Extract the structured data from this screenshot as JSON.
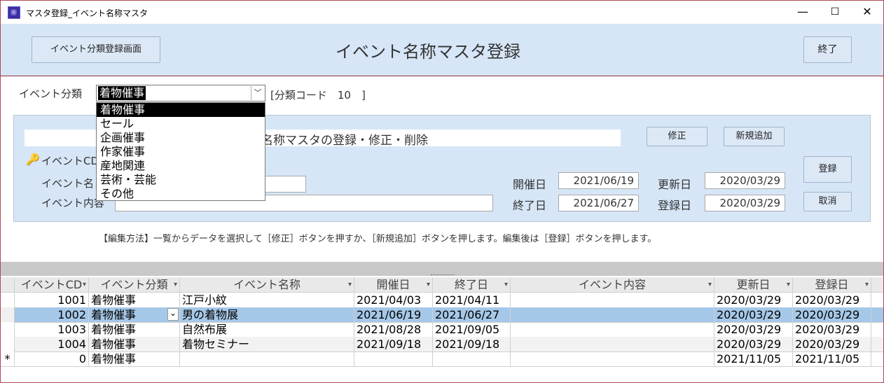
{
  "window": {
    "title": "マスタ登録_イベント名称マスタ",
    "minimize": "—",
    "maximize": "☐",
    "close": "✕"
  },
  "header": {
    "category_button": "イベント分類登録画面",
    "title": "イベント名称マスタ登録",
    "exit_button": "終了"
  },
  "filter": {
    "label": "イベント分類",
    "selected": "着物催事",
    "code_text": "[分類コード　10　]",
    "options": [
      "着物催事",
      "セール",
      "企画催事",
      "作家催事",
      "産地関連",
      "芸術・芸能",
      "その他"
    ]
  },
  "form": {
    "banner": "名称マスタの登録・修正・削除",
    "edit_button": "修正",
    "new_button": "新規追加",
    "register_button": "登録",
    "cancel_button": "取消",
    "event_cd_label": "イベントCD",
    "event_name_label": "イベント名",
    "event_content_label": "イベント内容",
    "start_label": "開催日",
    "start_value": "2021/06/19",
    "end_label": "終了日",
    "end_value": "2021/06/27",
    "updated_label": "更新日",
    "updated_value": "2020/03/29",
    "registered_label": "登録日",
    "registered_value": "2020/03/29",
    "event_name_value": "",
    "event_content_value": ""
  },
  "help_text": "【編集方法】一覧からデータを選択して［修正］ボタンを押すか、［新規追加］ボタンを押します。編集後は［登録］ボタンを押します。",
  "table": {
    "columns": [
      "イベントCD",
      "イベント分類",
      "イベント名称",
      "開催日",
      "終了日",
      "イベント内容",
      "更新日",
      "登録日"
    ],
    "rows": [
      {
        "cd": "1001",
        "category": "着物催事",
        "name": "江戸小紋",
        "start": "2021/04/03",
        "end": "2021/04/11",
        "content": "",
        "updated": "2020/03/29",
        "registered": "2020/03/29"
      },
      {
        "cd": "1002",
        "category": "着物催事",
        "name": "男の着物展",
        "start": "2021/06/19",
        "end": "2021/06/27",
        "content": "",
        "updated": "2020/03/29",
        "registered": "2020/03/29"
      },
      {
        "cd": "1003",
        "category": "着物催事",
        "name": "自然布展",
        "start": "2021/08/28",
        "end": "2021/09/05",
        "content": "",
        "updated": "2020/03/29",
        "registered": "2020/03/29"
      },
      {
        "cd": "1004",
        "category": "着物催事",
        "name": "着物セミナー",
        "start": "2021/09/18",
        "end": "2021/09/18",
        "content": "",
        "updated": "2020/03/29",
        "registered": "2020/03/29"
      },
      {
        "cd": "0",
        "category": "着物催事",
        "name": "",
        "start": "",
        "end": "",
        "content": "",
        "updated": "2021/11/05",
        "registered": "2021/11/05"
      }
    ],
    "new_row_marker": "*"
  },
  "colors": {
    "header_bg": "#d6e6f7",
    "selected_row": "#a6c8e8",
    "accent_border": "#8f2f3f"
  }
}
